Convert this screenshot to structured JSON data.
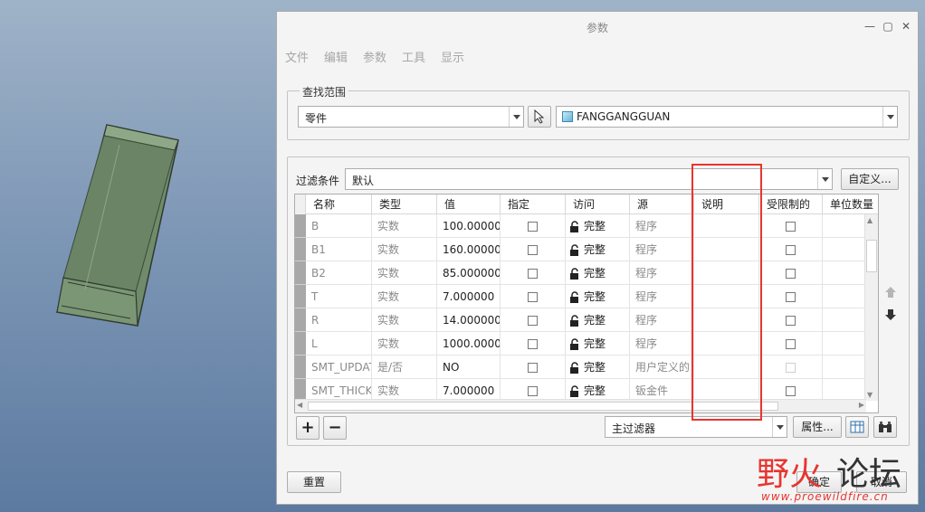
{
  "dialog": {
    "title": "参数",
    "menu": [
      "文件",
      "编辑",
      "参数",
      "工具",
      "显示"
    ]
  },
  "scope": {
    "label": "查找范围",
    "type_value": "零件",
    "model_value": "FANGGANGGUAN"
  },
  "filter": {
    "label": "过滤条件",
    "value": "默认",
    "customize_label": "自定义..."
  },
  "table": {
    "columns": [
      "名称",
      "类型",
      "值",
      "指定",
      "访问",
      "源",
      "说明",
      "受限制的",
      "单位数量"
    ],
    "rows": [
      {
        "name": "B",
        "type": "实数",
        "value": "100.000000",
        "access": "完整",
        "source": "程序"
      },
      {
        "name": "B1",
        "type": "实数",
        "value": "160.000000",
        "access": "完整",
        "source": "程序"
      },
      {
        "name": "B2",
        "type": "实数",
        "value": "85.000000",
        "access": "完整",
        "source": "程序"
      },
      {
        "name": "T",
        "type": "实数",
        "value": "7.000000",
        "access": "完整",
        "source": "程序"
      },
      {
        "name": "R",
        "type": "实数",
        "value": "14.000000",
        "access": "完整",
        "source": "程序"
      },
      {
        "name": "L",
        "type": "实数",
        "value": "1000.000000",
        "access": "完整",
        "source": "程序"
      },
      {
        "name": "SMT_UPDATE",
        "type": "是/否",
        "value": "NO",
        "access": "完整",
        "source": "用户定义的"
      },
      {
        "name": "SMT_THICKNESS",
        "type": "实数",
        "value": "7.000000",
        "access": "完整",
        "source": "钣金件"
      }
    ]
  },
  "footer": {
    "main_filter_value": "主过滤器",
    "properties_label": "属性...",
    "reset_label": "重置",
    "ok_label": "确定",
    "cancel_label": "取消"
  },
  "watermark": {
    "cn_red": "野火",
    "cn_dark": "论坛",
    "url": "www.proewildfire.cn"
  },
  "colors": {
    "annotation_red": "#e8352f",
    "model_green": "#6f8b6a"
  }
}
